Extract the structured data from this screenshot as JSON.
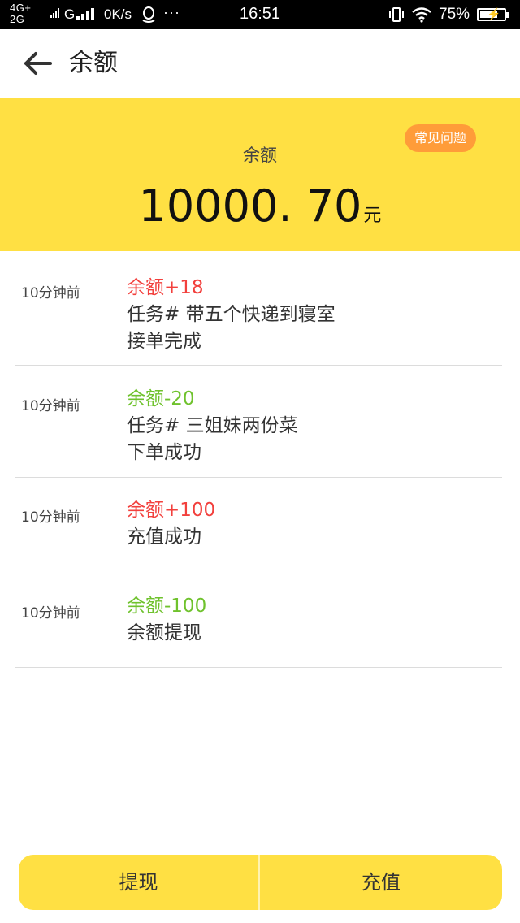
{
  "status_bar": {
    "network_top": "4G+",
    "network_bottom": "2G",
    "carrier_type": "G",
    "speed": "0K/s",
    "more": "···",
    "time": "16:51",
    "battery": "75%",
    "battery_level": 0.75
  },
  "header": {
    "title": "余额"
  },
  "balance": {
    "faq_label": "常见问题",
    "label": "余额",
    "amount": "10000. 70",
    "unit": "元"
  },
  "records": [
    {
      "time": "10分钟前",
      "change": "余额+18",
      "type": "income",
      "line1": "任务# 带五个快递到寝室",
      "line2": "接单完成"
    },
    {
      "time": "10分钟前",
      "change": "余额-20",
      "type": "expense",
      "line1": "任务# 三姐妹两份菜",
      "line2": "下单成功"
    },
    {
      "time": "10分钟前",
      "change": "余额+100",
      "type": "income",
      "line1": "充值成功",
      "line2": ""
    },
    {
      "time": "10分钟前",
      "change": "余额-100",
      "type": "expense",
      "line1": "余额提现",
      "line2": ""
    }
  ],
  "actions": {
    "withdraw_label": "提现",
    "recharge_label": "充值"
  },
  "colors": {
    "accent_yellow": "#ffe043",
    "faq_orange": "#ff9c39",
    "income_red": "#f2403d",
    "expense_green": "#6fc22d"
  },
  "icons": {
    "back": "back-arrow-icon",
    "qq": "qq-penguin-icon",
    "wifi": "wifi-icon",
    "vibrate": "vibrate-icon",
    "battery": "battery-icon"
  }
}
